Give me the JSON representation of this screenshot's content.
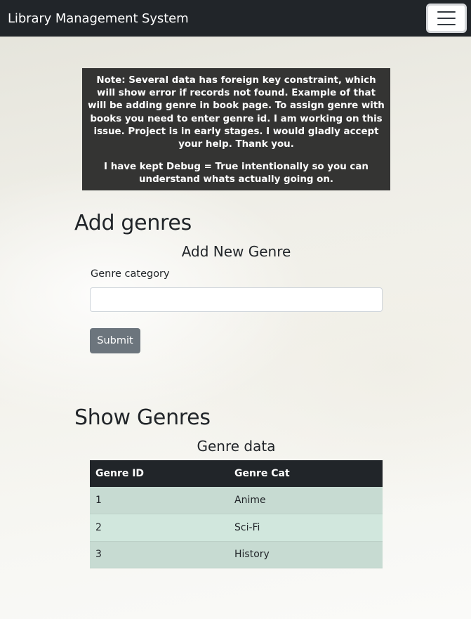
{
  "navbar": {
    "brand": "Library Management System"
  },
  "note": {
    "paragraph1": "Note: Several data has foreign key constraint, which will show error if records not found. Example of that will be adding genre in book page. To assign genre with books you need to enter genre id. I am working on this issue. Project is in early stages. I would gladly accept your help. Thank you.",
    "paragraph2": "I have kept Debug = True intentionally so you can understand whats actually going on."
  },
  "add_section": {
    "heading": "Add genres",
    "form_title": "Add New Genre",
    "field_label": "Genre category",
    "field_value": "",
    "submit_label": "Submit"
  },
  "show_section": {
    "heading": "Show Genres",
    "table_title": "Genre data",
    "columns": [
      "Genre ID",
      "Genre Cat"
    ],
    "rows": [
      [
        "1",
        "Anime"
      ],
      [
        "2",
        "Sci-Fi"
      ],
      [
        "3",
        "History"
      ]
    ]
  }
}
